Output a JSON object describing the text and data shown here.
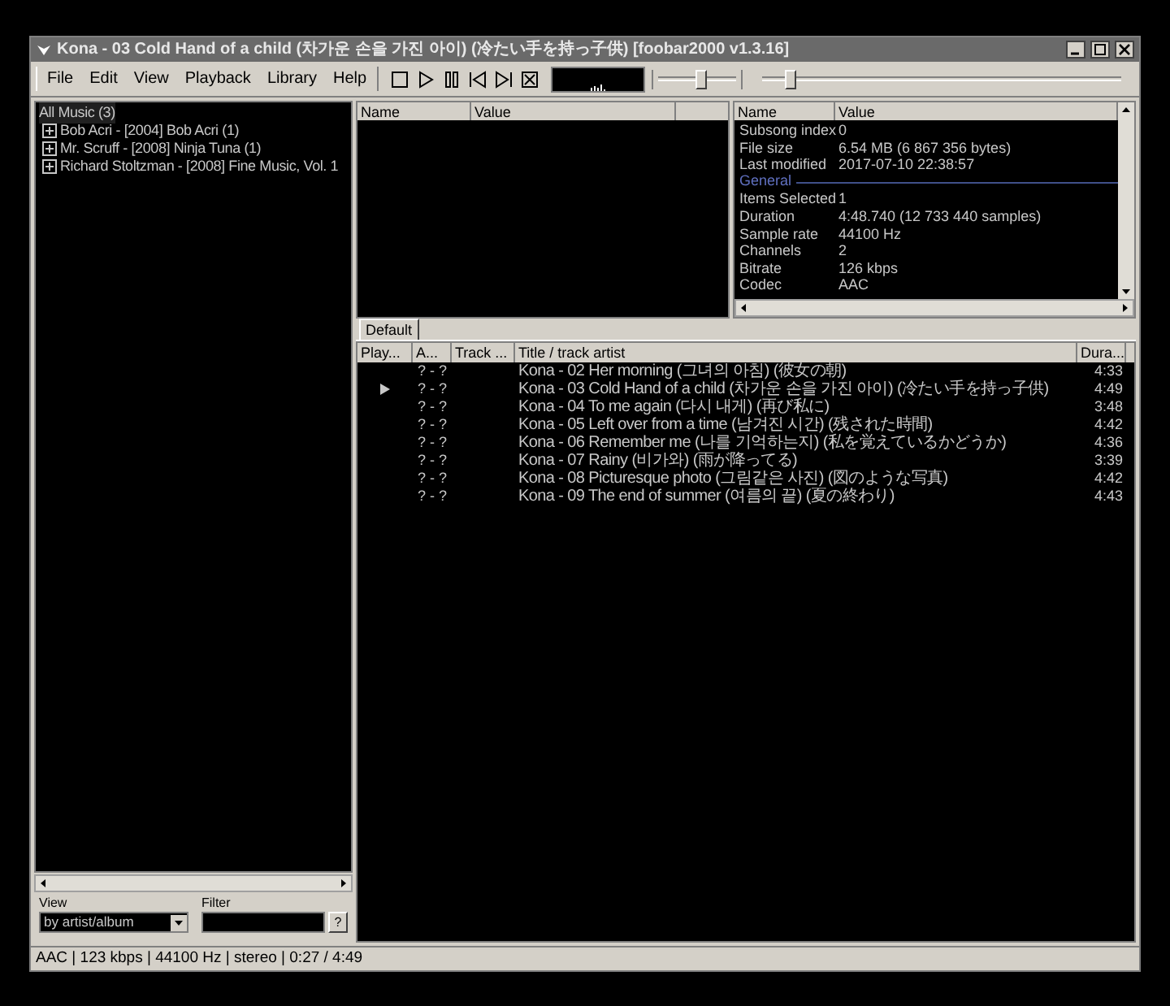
{
  "window": {
    "title": "Kona - 03 Cold Hand of a child (차가운 손을 가진 아이) (冷たい手を持っ子供)   [foobar2000 v1.3.16]"
  },
  "menu": [
    "File",
    "Edit",
    "View",
    "Playback",
    "Library",
    "Help"
  ],
  "volume": {
    "level": 0.55
  },
  "seekbar": {
    "level": 0.08
  },
  "library": {
    "items": [
      {
        "label": "All Music (3)",
        "expanded": true,
        "children": [
          {
            "label": "Bob Acri - [2004] Bob Acri (1)",
            "expanded": false
          },
          {
            "label": "Mr. Scruff - [2008] Ninja Tuna (1)",
            "expanded": false
          },
          {
            "label": "Richard Stoltzman - [2008] Fine Music, Vol. 1",
            "expanded": false
          }
        ]
      }
    ],
    "view_label": "View",
    "view_value": "by artist/album",
    "filter_label": "Filter",
    "filter_button": "?"
  },
  "selection_panel": {
    "columns": [
      "Name",
      "Value"
    ]
  },
  "properties": {
    "columns": [
      "Name",
      "Value"
    ],
    "rows": [
      {
        "kind": "item",
        "name": "Subsong index",
        "value": "0"
      },
      {
        "kind": "item",
        "name": "File size",
        "value": "6.54 MB (6 867 356 bytes)"
      },
      {
        "kind": "item",
        "name": "Last modified",
        "value": "2017-07-10 22:38:57"
      },
      {
        "kind": "group",
        "name": "General"
      },
      {
        "kind": "item",
        "name": "Items Selected",
        "value": "1"
      },
      {
        "kind": "item",
        "name": "Duration",
        "value": "4:48.740 (12 733 440 samples)"
      },
      {
        "kind": "item",
        "name": "Sample rate",
        "value": "44100 Hz"
      },
      {
        "kind": "item",
        "name": "Channels",
        "value": "2"
      },
      {
        "kind": "item",
        "name": "Bitrate",
        "value": "126 kbps"
      },
      {
        "kind": "item",
        "name": "Codec",
        "value": "AAC"
      }
    ]
  },
  "playlist_tabs": [
    {
      "label": "Default",
      "selected": true
    }
  ],
  "playlist": {
    "columns": [
      "Play...",
      "A...",
      "Track ...",
      "Title / track artist",
      "Dura..."
    ],
    "rows": [
      {
        "playing": false,
        "column_2": "? - ?",
        "title": "Kona - 02 Her morning (그녀의 아침) (彼女の朝)",
        "duration": "4:33"
      },
      {
        "playing": true,
        "column_2": "? - ?",
        "title": "Kona - 03 Cold Hand of a child (차가운 손을 가진 아이) (冷たい手を持っ子供)",
        "duration": "4:49"
      },
      {
        "playing": false,
        "column_2": "? - ?",
        "title": "Kona - 04 To me again (다시 내게) (再び私に)",
        "duration": "3:48"
      },
      {
        "playing": false,
        "column_2": "? - ?",
        "title": "Kona - 05 Left over from a time (남겨진 시간) (残された時間)",
        "duration": "4:42"
      },
      {
        "playing": false,
        "column_2": "? - ?",
        "title": "Kona - 06 Remember me (나를 기억하는지) (私を覚えているかどうか)",
        "duration": "4:36"
      },
      {
        "playing": false,
        "column_2": "? - ?",
        "title": "Kona - 07 Rainy (비가와) (雨が降ってる)",
        "duration": "3:39"
      },
      {
        "playing": false,
        "column_2": "? - ?",
        "title": "Kona - 08 Picturesque photo (그림같은 사진) (図のような写真)",
        "duration": "4:42"
      },
      {
        "playing": false,
        "column_2": "? - ?",
        "title": "Kona - 09 The end of summer (여름의 끝) (夏の終わり)",
        "duration": "4:43"
      }
    ]
  },
  "status_bar": "AAC | 123 kbps | 44100 Hz | stereo | 0:27 / 4:49"
}
